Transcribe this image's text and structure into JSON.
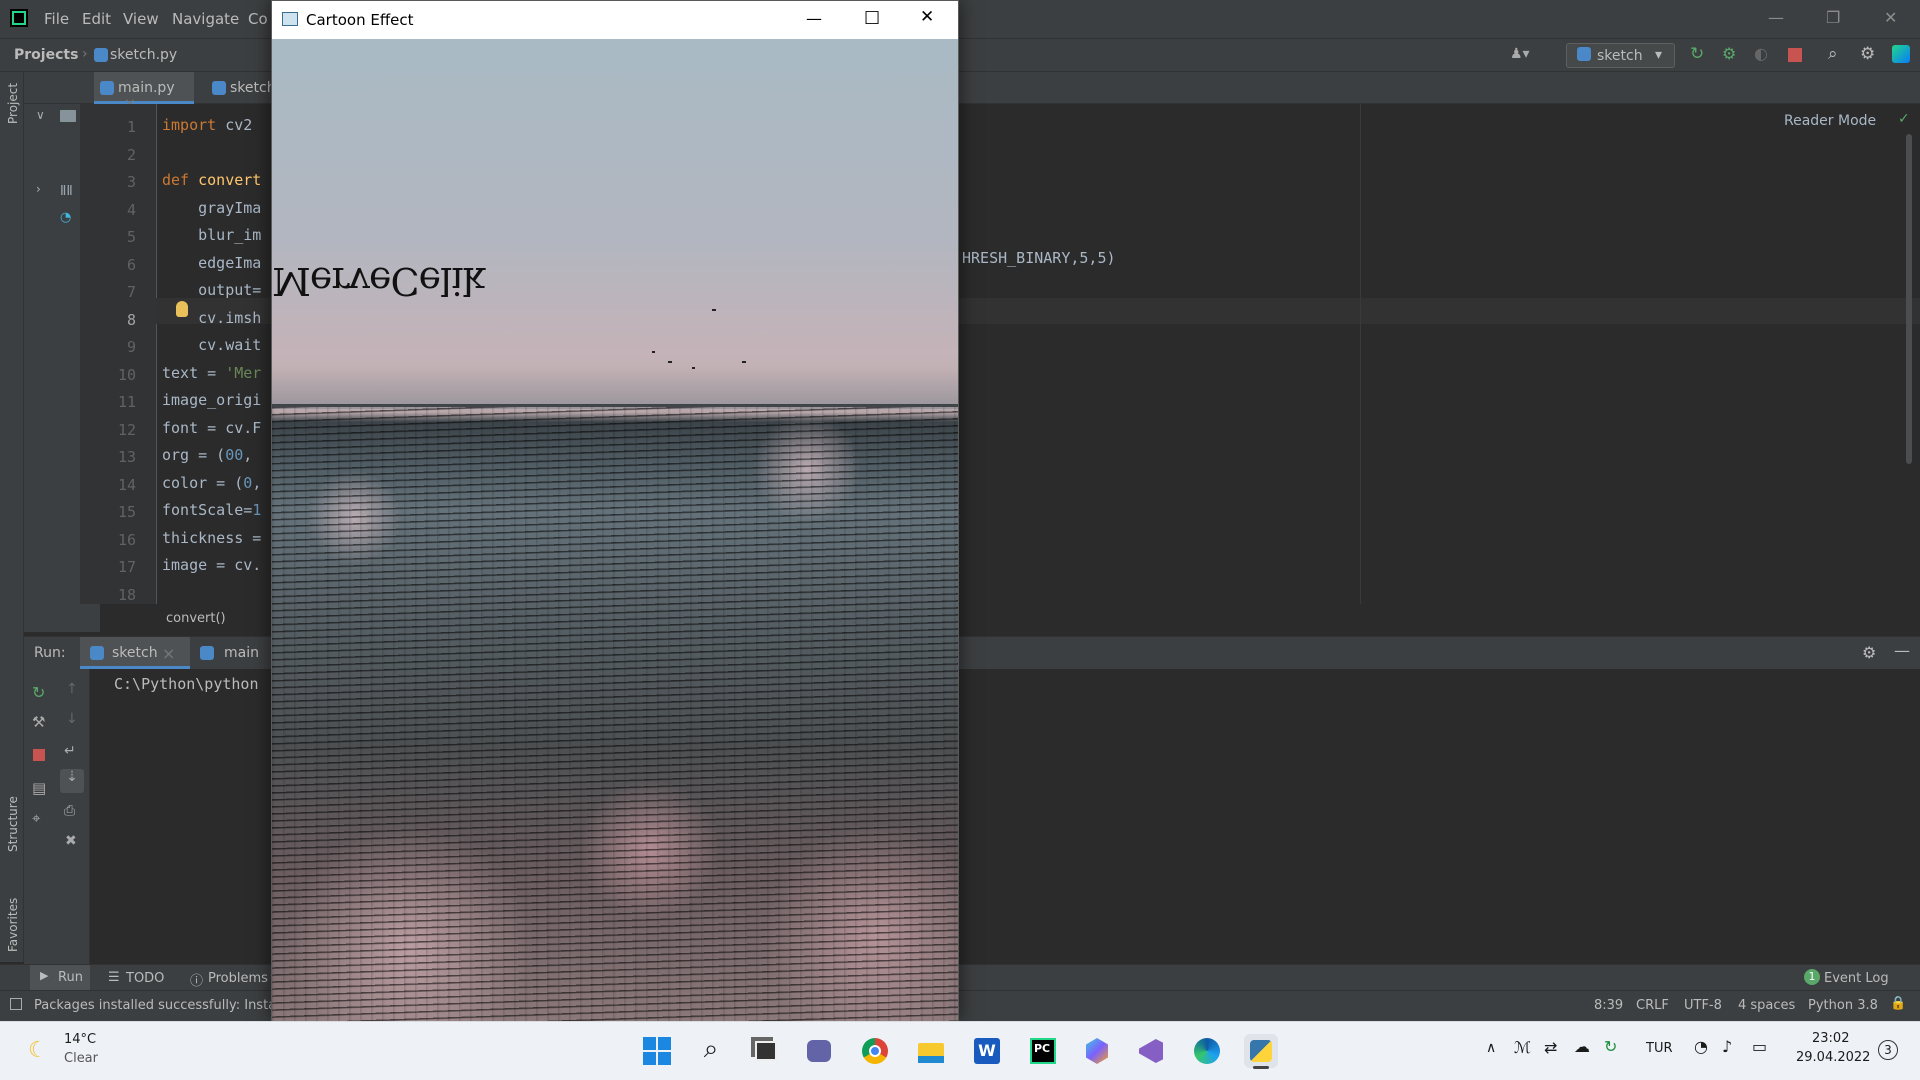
{
  "ide": {
    "menu": [
      "File",
      "Edit",
      "View",
      "Navigate",
      "Co"
    ],
    "breadcrumb_projects": "Projects",
    "breadcrumb_file": "sketch.py",
    "run_config": "sketch",
    "tabs": [
      "main.py",
      "sketch"
    ],
    "reader_mode": "Reader Mode",
    "line_numbers": [
      "1",
      "2",
      "3",
      "4",
      "5",
      "6",
      "7",
      "8",
      "9",
      "10",
      "11",
      "12",
      "13",
      "14",
      "15",
      "16",
      "17",
      "18"
    ],
    "code_lines": [
      "import cv2",
      "",
      "def convert",
      "    grayIma",
      "    blur_im",
      "    edgeIma",
      "    output=",
      "    cv.imsh",
      "    cv.wait",
      "text = 'Mer",
      "image_origi",
      "font = cv.F",
      "org = (00, ",
      "color = (0,",
      "fontScale=1",
      "thickness =",
      "image = cv."
    ],
    "code_tail": "HRESH_BINARY,5,5)",
    "breadcrumb_func": "convert()",
    "run_label": "Run:",
    "run_tabs": [
      "sketch",
      "main"
    ],
    "console_line": "C:\\Python\\python",
    "sidebar_project": "Project",
    "sidebar_structure": "Structure",
    "sidebar_favorites": "Favorites",
    "bottom_tabs": [
      "Run",
      "TODO",
      "Problems"
    ],
    "event_log": "Event Log",
    "event_count": "1",
    "status_message": "Packages installed successfully: Insta",
    "status": {
      "position": "8:39",
      "line_sep": "CRLF",
      "encoding": "UTF-8",
      "indent": "4 spaces",
      "interpreter": "Python 3.8"
    }
  },
  "cv_window": {
    "title": "Cartoon Effect",
    "overlay_text": "MerveCelik"
  },
  "taskbar": {
    "weather_temp": "14°C",
    "weather_desc": "Clear",
    "lang": "TUR",
    "time": "23:02",
    "date": "29.04.2022",
    "notification_count": "3",
    "apps": [
      "start",
      "search",
      "task-view",
      "teams",
      "chrome",
      "file-explorer",
      "word",
      "pycharm",
      "app-hex",
      "visual-studio",
      "edge",
      "python"
    ]
  },
  "colors": {
    "ide_bg": "#2b2b2b",
    "ide_panel": "#3c3f41",
    "keyword": "#cc7832",
    "function": "#ffc66d",
    "number": "#6897bb",
    "string": "#6a8759",
    "text": "#a9b7c6"
  }
}
